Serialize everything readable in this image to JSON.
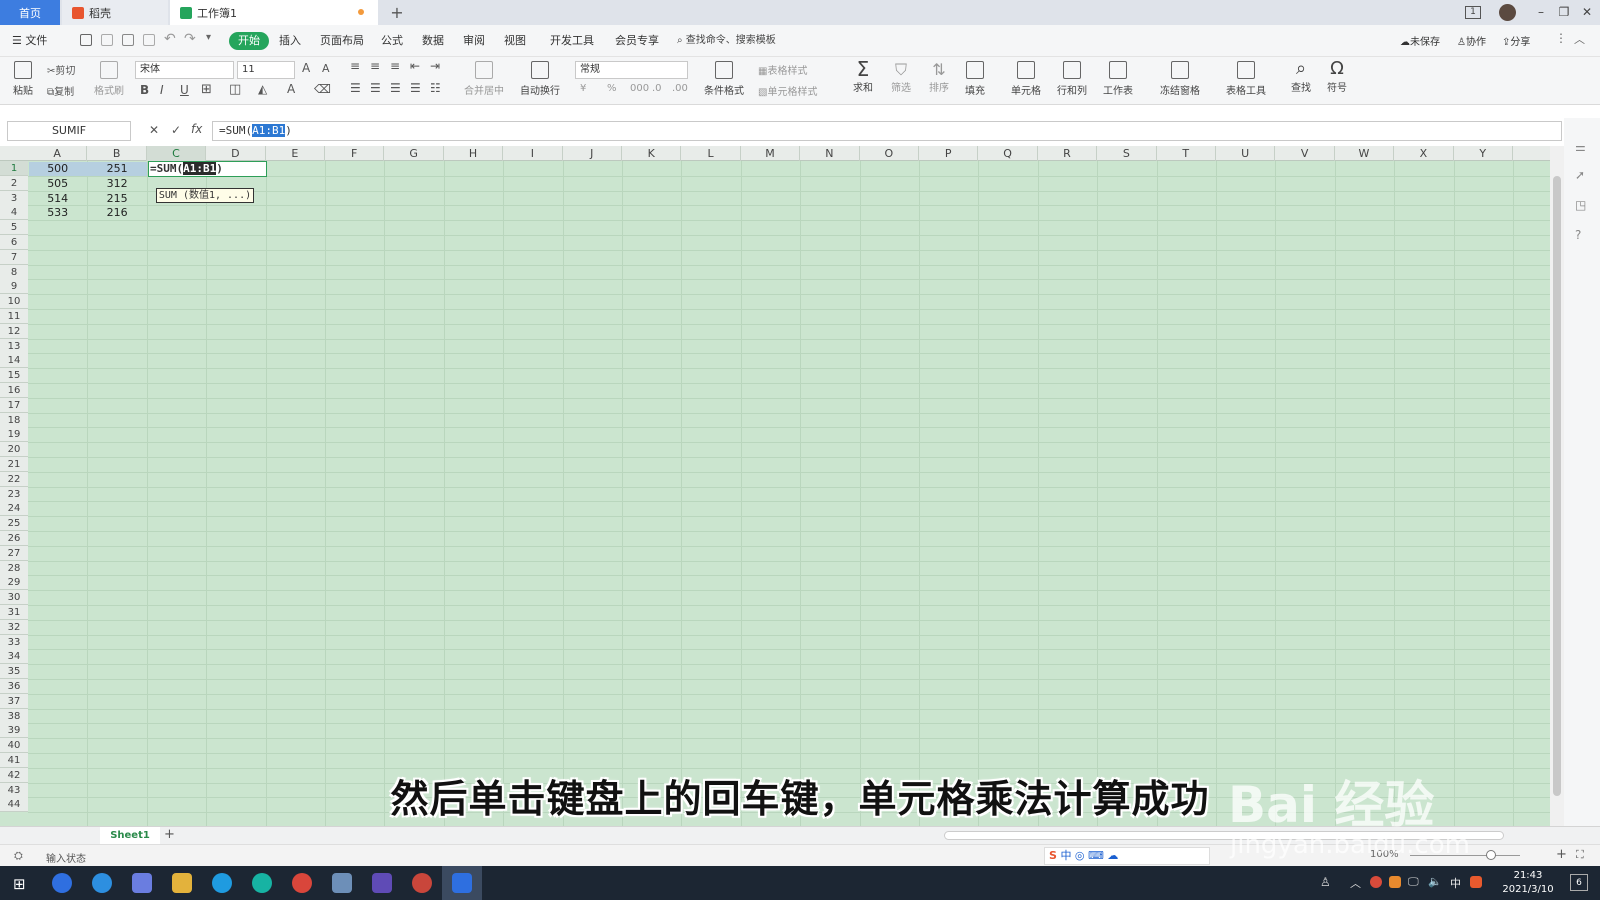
{
  "tabs": {
    "home": "首页",
    "daoke": "稻壳",
    "workbook": "工作簿1",
    "add": "+"
  },
  "window": {
    "badge": "1",
    "minimize": "–",
    "restore": "❐",
    "close": "✕"
  },
  "menu": {
    "file": "☰ 文件",
    "items": [
      "开始",
      "插入",
      "页面布局",
      "公式",
      "数据",
      "审阅",
      "视图",
      "开发工具",
      "会员专享"
    ],
    "search": "查找命令、搜索模板",
    "unsaved": "未保存",
    "collab": "协作",
    "share": "分享"
  },
  "ribbon": {
    "paste": "粘贴",
    "cut": "剪切",
    "copy": "复制",
    "format_painter": "格式刷",
    "font_name": "宋体",
    "font_size": "11",
    "merge": "合并居中",
    "wrap": "自动换行",
    "number_format": "常规",
    "cond_format": "条件格式",
    "table_style": "表格样式",
    "cell_style": "单元格样式",
    "sum": "求和",
    "filter": "筛选",
    "sort": "排序",
    "fill": "填充",
    "cells": "单元格",
    "rowcol": "行和列",
    "sheet": "工作表",
    "freeze": "冻结窗格",
    "table_tools": "表格工具",
    "find": "查找",
    "symbol": "符号"
  },
  "formula_bar": {
    "name_box": "SUMIF",
    "cancel": "✕",
    "confirm": "✓",
    "fx": "fx",
    "prefix": "=SUM(",
    "ref": "A1:B1",
    "suffix": ")"
  },
  "columns": [
    "A",
    "B",
    "C",
    "D",
    "E",
    "F",
    "G",
    "H",
    "I",
    "J",
    "K",
    "L",
    "M",
    "N",
    "O",
    "P",
    "Q",
    "R",
    "S",
    "T",
    "U",
    "V",
    "W",
    "X",
    "Y"
  ],
  "rows": [
    "1",
    "2",
    "3",
    "4",
    "5",
    "6",
    "7",
    "8",
    "9",
    "10",
    "11",
    "12",
    "13",
    "14",
    "15",
    "16",
    "17",
    "18",
    "19",
    "20",
    "21",
    "22",
    "23",
    "24",
    "25",
    "26",
    "27",
    "28",
    "29",
    "30",
    "31",
    "32",
    "33",
    "34",
    "35",
    "36",
    "37",
    "38",
    "39",
    "40",
    "41",
    "42",
    "43",
    "44"
  ],
  "cells": {
    "A": [
      "500",
      "505",
      "514",
      "533"
    ],
    "B": [
      "251",
      "312",
      "215",
      "216"
    ]
  },
  "edit_cell": {
    "prefix": "=SUM(",
    "ref": "A1:B1",
    "suffix": ")"
  },
  "tooltip": "SUM (数值1, ...)",
  "sheet": {
    "tab": "Sheet1",
    "add": "+"
  },
  "status": {
    "mode": "输入状态",
    "zoom": "100%"
  },
  "taskbar": {
    "time": "21:43",
    "date": "2021/3/10",
    "ime": "中",
    "notify": "6"
  },
  "subtitle": "然后单击键盘上的回车键，单元格乘法计算成功",
  "watermark": {
    "brand": "Bai 经验",
    "url": "jingyan.baidu.com"
  },
  "colors": {
    "accent": "#25a55c",
    "tab_home": "#3d7de0",
    "grid_bg": "#cbe5cf",
    "selection": "#2c78d3"
  }
}
